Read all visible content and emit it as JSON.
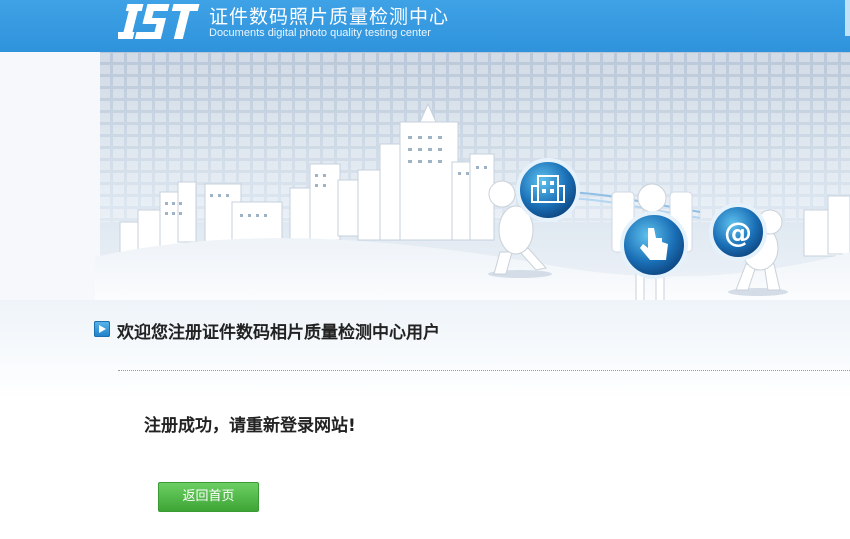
{
  "header": {
    "logo_text": "IST",
    "title_cn": "证件数码照片质量检测中心",
    "title_en": "Documents digital photo quality testing center"
  },
  "main": {
    "welcome_heading": "欢迎您注册证件数码相片质量检测中心用户",
    "message": "注册成功，请重新登录网站!",
    "home_button_label": "返回首页"
  },
  "colors": {
    "header_blue": "#3fa2e6",
    "button_green": "#4cb944"
  },
  "icons": [
    "building-icon",
    "hand-pointer-icon",
    "at-sign-icon",
    "play-arrow-icon"
  ]
}
